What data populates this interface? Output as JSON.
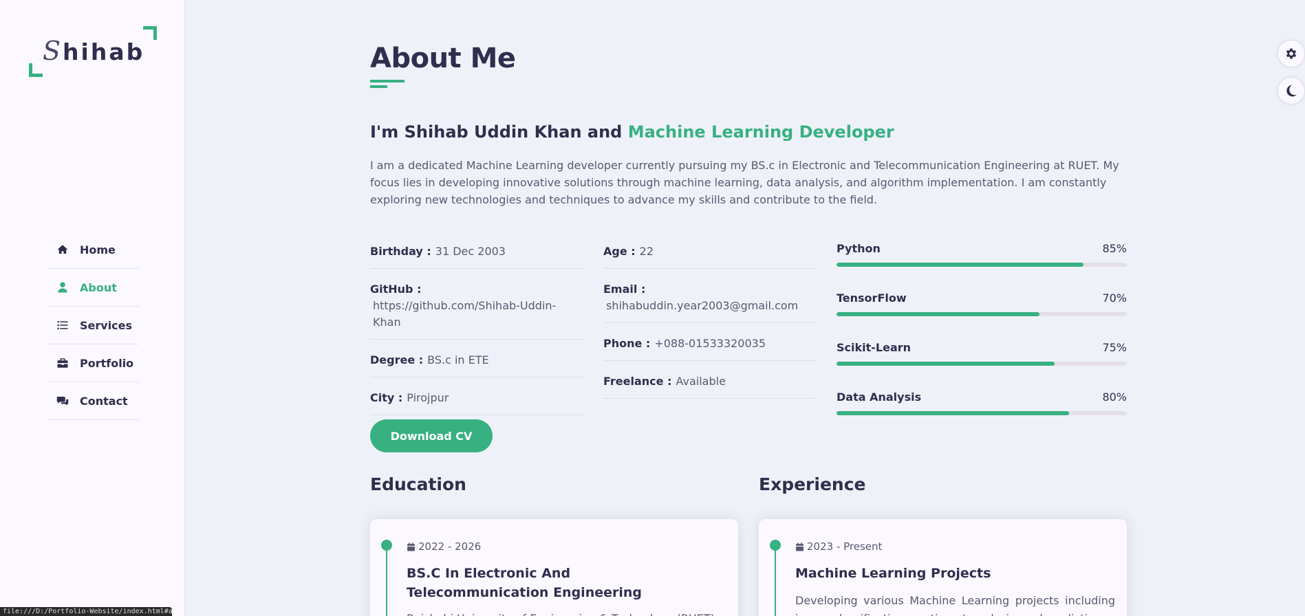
{
  "logo": {
    "first_letter": "S",
    "rest": "hihab"
  },
  "nav": [
    {
      "label": "Home",
      "icon": "home-icon",
      "active": false
    },
    {
      "label": "About",
      "icon": "user-icon",
      "active": true
    },
    {
      "label": "Services",
      "icon": "list-icon",
      "active": false
    },
    {
      "label": "Portfolio",
      "icon": "briefcase-icon",
      "active": false
    },
    {
      "label": "Contact",
      "icon": "comments-icon",
      "active": false
    }
  ],
  "controls": {
    "settings_icon": "gear-icon",
    "theme_icon": "moon-icon"
  },
  "about": {
    "title": "About Me",
    "intro_prefix": "I'm Shihab Uddin Khan and ",
    "intro_role": "Machine Learning Developer",
    "intro_text": "I am a dedicated Machine Learning developer currently pursuing my BS.c in Electronic and Telecommunication Engineering at RUET. My focus lies in developing innovative solutions through machine learning, data analysis, and algorithm implementation. I am constantly exploring new technologies and techniques to advance my skills and contribute to the field.",
    "info_left": [
      {
        "label": "Birthday :",
        "value": "31 Dec 2003"
      },
      {
        "label": "GitHub :",
        "value": "https://github.com/Shihab-Uddin-Khan"
      },
      {
        "label": "Degree :",
        "value": "BS.c in ETE"
      },
      {
        "label": "City :",
        "value": "Pirojpur"
      }
    ],
    "info_right": [
      {
        "label": "Age :",
        "value": "22"
      },
      {
        "label": "Email :",
        "value": "shihabuddin.year2003@gmail.com"
      },
      {
        "label": "Phone :",
        "value": "+088-01533320035"
      },
      {
        "label": "Freelance :",
        "value": "Available"
      }
    ],
    "skills": [
      {
        "name": "Python",
        "percent": "85%",
        "level": 85
      },
      {
        "name": "TensorFlow",
        "percent": "70%",
        "level": 70
      },
      {
        "name": "Scikit-Learn",
        "percent": "75%",
        "level": 75
      },
      {
        "name": "Data Analysis",
        "percent": "80%",
        "level": 80
      }
    ],
    "cv_button": "Download CV"
  },
  "education": {
    "title": "Education",
    "date": "2022 - 2026",
    "item_title": "BS.C In Electronic And Telecommunication Engineering",
    "text": "Rajshahi University of Engineering & Technology (RUET)"
  },
  "experience": {
    "title": "Experience",
    "date": "2023 - Present",
    "item_title": "Machine Learning Projects",
    "text": "Developing various Machine Learning projects including image classification, sentiment analysis, and predictive"
  },
  "status_url": "file:///D:/Portfolio-Website/index.html#about",
  "colors": {
    "accent": "#37b182",
    "text": "#302e4d",
    "background": "#eff1f8",
    "sidebar": "#fcf8ff"
  }
}
